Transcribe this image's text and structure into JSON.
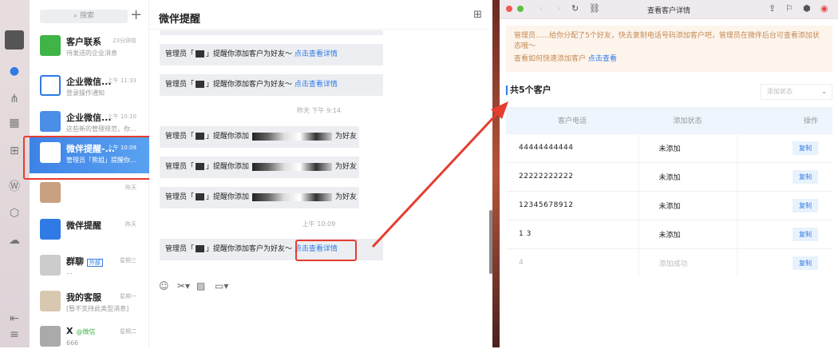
{
  "list": {
    "search_placeholder": "搜索",
    "items": [
      {
        "name": "客户联系",
        "preview": "待发送的企业消息",
        "time": "23分钟前",
        "color": "#3fb447"
      },
      {
        "name": "企业微信...",
        "preview": "登录操作通知",
        "time": "上午 11:33",
        "color": "#ffffff"
      },
      {
        "name": "企业微信...",
        "preview": "这些新的管理规范，你...",
        "time": "上午 10:10",
        "color": "#4a8ee8"
      },
      {
        "name": "微伴提醒-...",
        "preview": "管理员「熊姐」提醒你...",
        "time": "上午 10:09",
        "color": "#ffffff"
      },
      {
        "name": "",
        "preview": "",
        "time": "昨天",
        "color": "#c9a080"
      },
      {
        "name": "微伴提醒",
        "preview": "",
        "time": "昨天",
        "color": "#2f7ae5"
      },
      {
        "name": "群聊",
        "badge": "外部",
        "preview": "...",
        "time": "星期三",
        "color": "#ccc"
      },
      {
        "name": "我的客服",
        "preview": "[暂不支持此类型消息]",
        "time": "星期一",
        "color": "#d9c8b0"
      },
      {
        "name": "X",
        "tag": "@微信",
        "preview": "666",
        "time": "星期二",
        "color": "#aaa"
      }
    ]
  },
  "chat": {
    "title": "微伴提醒",
    "msg_prefix": "管理员「",
    "msg_mid": "」提醒你添加客户为好友～",
    "msg_link": "点击查看详情",
    "msg_mid2": "」提醒你添加",
    "msg_suffix": "为好友",
    "ts1": "昨天 下午 9:14",
    "ts2": "上午 10:09"
  },
  "browser": {
    "title": "查看客户详情",
    "notice_line1": "管理员......给你分配了5个好友，快去复制电话号码添加客户吧，管理员在微伴后台可查看添加状态哦～",
    "notice_line2": "查看如何快速添加客户",
    "notice_link": "点击查看",
    "count": "共5个客户",
    "filter_placeholder": "添加状态",
    "headers": [
      "客户电话",
      "添加状态",
      "操作"
    ],
    "rows": [
      {
        "phone": "44444444444",
        "status": "未添加",
        "action": "复制"
      },
      {
        "phone": "22222222222",
        "status": "未添加",
        "action": "复制"
      },
      {
        "phone": "12345678912",
        "status": "未添加",
        "action": "复制"
      },
      {
        "phone": "1          3",
        "status": "未添加",
        "action": "复制"
      },
      {
        "phone": "          4",
        "status": "添加成功",
        "action": "复制"
      }
    ]
  },
  "colors": {
    "accent": "#2f7ae5",
    "highlight": "#e53d2f"
  }
}
